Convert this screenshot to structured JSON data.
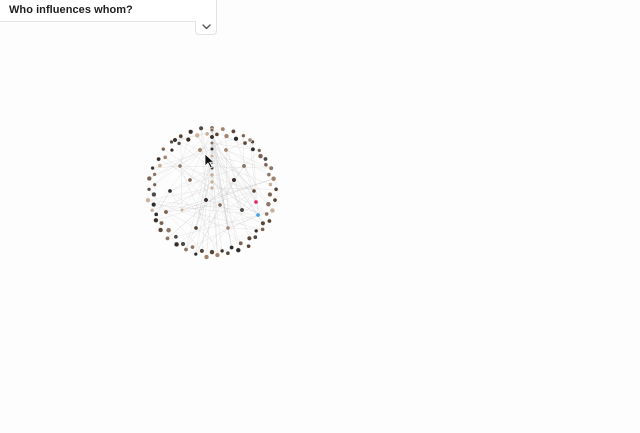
{
  "header": {
    "title": "Who influences whom?",
    "toggle_icon": "chevron-down-icon"
  },
  "graph": {
    "type": "network",
    "accent_colors": [
      "#e0245e",
      "#4aa3df",
      "#9b9b9b"
    ],
    "node_icon": "avatar-node",
    "cursor_icon": "arrow-cursor-icon"
  }
}
